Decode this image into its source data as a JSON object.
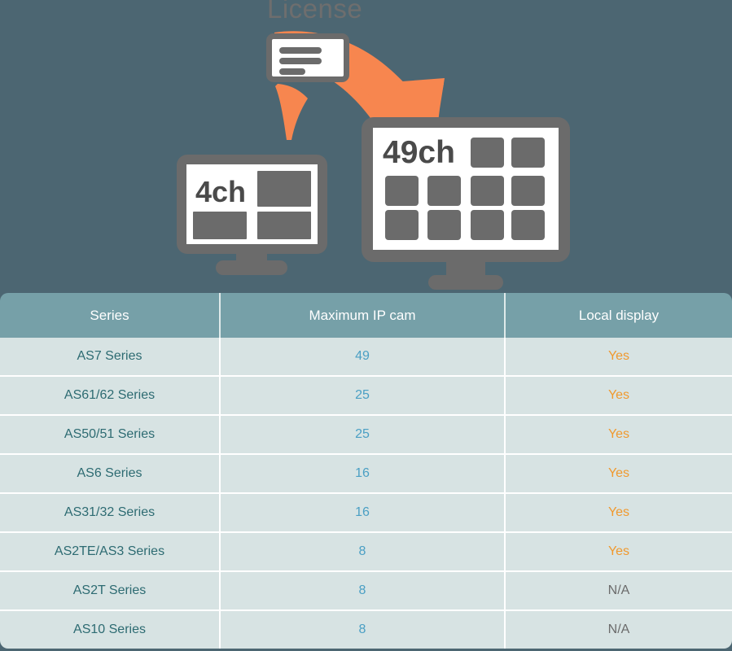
{
  "illustration": {
    "license_label": "License",
    "small_monitor": {
      "channel_label": "4ch",
      "tiles": 3,
      "name": "4-channel monitor"
    },
    "large_monitor": {
      "channel_label": "49ch",
      "tiles": 10,
      "name": "49-channel monitor"
    },
    "arrow": {
      "name": "upgrade-arrow",
      "color": "#f7864f",
      "direction": "curved-right-down"
    },
    "license_card": {
      "name": "license-card",
      "lines": 3
    },
    "colors": {
      "background": "#4c6672",
      "device_gray": "#6b6b6b",
      "screen_white": "#ffffff",
      "tile_gray": "#6b6b6b",
      "accent_orange": "#f7864f",
      "label_gray": "#6e6e6e"
    }
  },
  "table": {
    "name": "ip-camera-spec-table",
    "headers": [
      "Series",
      "Maximum IP cam",
      "Local display"
    ],
    "colors": {
      "header_bg": "#76a0a8",
      "header_text": "#ffffff",
      "row_bg": "#d7e3e3",
      "series_text": "#2d6b72",
      "number_text": "#4a9fc4",
      "yes_text": "#f0992e",
      "na_text": "#6b6b6b",
      "divider": "#ffffff"
    },
    "rows": [
      {
        "series": "AS7 Series",
        "max_ip_cam": "49",
        "local_display": "Yes"
      },
      {
        "series": "AS61/62 Series",
        "max_ip_cam": "25",
        "local_display": "Yes"
      },
      {
        "series": "AS50/51 Series",
        "max_ip_cam": "25",
        "local_display": "Yes"
      },
      {
        "series": "AS6 Series",
        "max_ip_cam": "16",
        "local_display": "Yes"
      },
      {
        "series": "AS31/32 Series",
        "max_ip_cam": "16",
        "local_display": "Yes"
      },
      {
        "series": "AS2TE/AS3 Series",
        "max_ip_cam": "8",
        "local_display": "Yes"
      },
      {
        "series": "AS2T Series",
        "max_ip_cam": "8",
        "local_display": "N/A"
      },
      {
        "series": "AS10 Series",
        "max_ip_cam": "8",
        "local_display": "N/A"
      }
    ]
  }
}
